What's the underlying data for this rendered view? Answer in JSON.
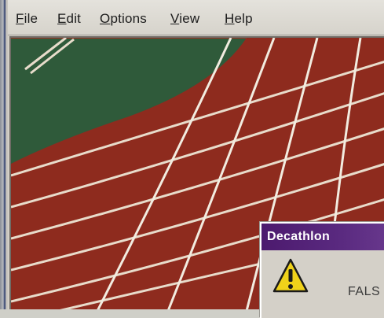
{
  "menubar": {
    "items": [
      {
        "label": "File",
        "accel": "F",
        "rest": "ile"
      },
      {
        "label": "Edit",
        "accel": "E",
        "rest": "dit"
      },
      {
        "label": "Options",
        "accel": "O",
        "rest": "ptions"
      },
      {
        "label": "View",
        "accel": "V",
        "rest": "iew"
      },
      {
        "label": "Help",
        "accel": "H",
        "rest": "elp"
      }
    ]
  },
  "dialog": {
    "title": "Decathlon",
    "icon": "warning-icon",
    "message": "FALS"
  },
  "colors": {
    "track": "#8e2b1e",
    "infield": "#2f5a3a",
    "lane_line": "#e8dccb",
    "dialog_title_bg": "#4c1a6e"
  }
}
